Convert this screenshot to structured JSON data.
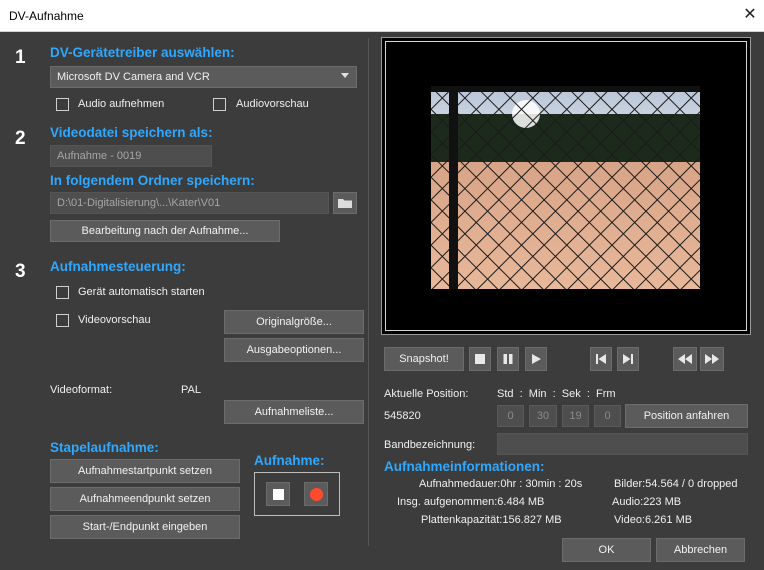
{
  "window": {
    "title": "DV-Aufnahme"
  },
  "steps": {
    "one": "1",
    "two": "2",
    "three": "3"
  },
  "section1": {
    "heading": "DV-Gerätetreiber auswählen:",
    "driver_value": "Microsoft DV Camera and VCR",
    "audio_record_label": "Audio aufnehmen",
    "audio_preview_label": "Audiovorschau"
  },
  "section2": {
    "heading": "Videodatei speichern als:",
    "filename_value": "Aufnahme - 0019",
    "folder_heading": "In folgendem Ordner speichern:",
    "folder_value": "D:\\01-Digitalisierung\\...\\Kater\\V01",
    "edit_after_button": "Bearbeitung nach der Aufnahme..."
  },
  "section3": {
    "heading": "Aufnahmesteuerung:",
    "auto_start_label": "Gerät automatisch starten",
    "video_preview_label": "Videovorschau",
    "original_size_button": "Originalgröße...",
    "output_options_button": "Ausgabeoptionen...",
    "videoformat_label": "Videoformat:",
    "videoformat_value": "PAL",
    "capture_list_button": "Aufnahmeliste..."
  },
  "batch": {
    "heading": "Stapelaufnahme:",
    "set_start_button": "Aufnahmestartpunkt setzen",
    "set_end_button": "Aufnahmeendpunkt setzen",
    "enter_points_button": "Start-/Endpunkt eingeben"
  },
  "capture": {
    "heading": "Aufnahme:"
  },
  "transport": {
    "snapshot_button": "Snapshot!"
  },
  "position": {
    "current_label": "Aktuelle Position:",
    "current_value": "545820",
    "tc_header": "Std  :  Min  :  Sek  :  Frm",
    "hours": "0",
    "minutes": "30",
    "seconds": "19",
    "frames": "0",
    "goto_button": "Position anfahren",
    "tape_label": "Bandbezeichnung:",
    "tape_value": ""
  },
  "capture_info": {
    "heading": "Aufnahmeinformationen:",
    "duration": "Aufnahmedauer:0hr : 30min : 20s",
    "total": "Insg. aufgenommen:6.484 MB",
    "disk": "Plattenkapazität:156.827 MB",
    "frames": "Bilder:54.564 / 0 dropped",
    "audio": "Audio:223 MB",
    "video": "Video:6.261 MB"
  },
  "footer": {
    "ok_button": "OK",
    "cancel_button": "Abbrechen"
  }
}
